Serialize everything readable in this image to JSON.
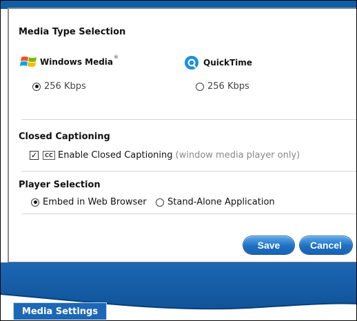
{
  "media_type": {
    "heading": "Media Type Selection",
    "windows": {
      "label": "Windows Media",
      "trademark": "®",
      "option": "256 Kbps",
      "selected": true
    },
    "quicktime": {
      "label": "QuickTime",
      "option": "256 Kbps",
      "selected": false
    }
  },
  "closed_captioning": {
    "heading": "Closed Captioning",
    "cc_icon": "CC",
    "checked": true,
    "label": "Enable Closed Captioning",
    "note": "(window media player only)"
  },
  "player_selection": {
    "heading": "Player Selection",
    "options": [
      {
        "label": "Embed in Web Browser",
        "selected": true
      },
      {
        "label": "Stand-Alone Application",
        "selected": false
      }
    ]
  },
  "buttons": {
    "save": "Save",
    "cancel": "Cancel"
  },
  "tab": {
    "label": "Media Settings"
  },
  "colors": {
    "accent": "#1d68b6",
    "band": "#0d5ea6"
  }
}
